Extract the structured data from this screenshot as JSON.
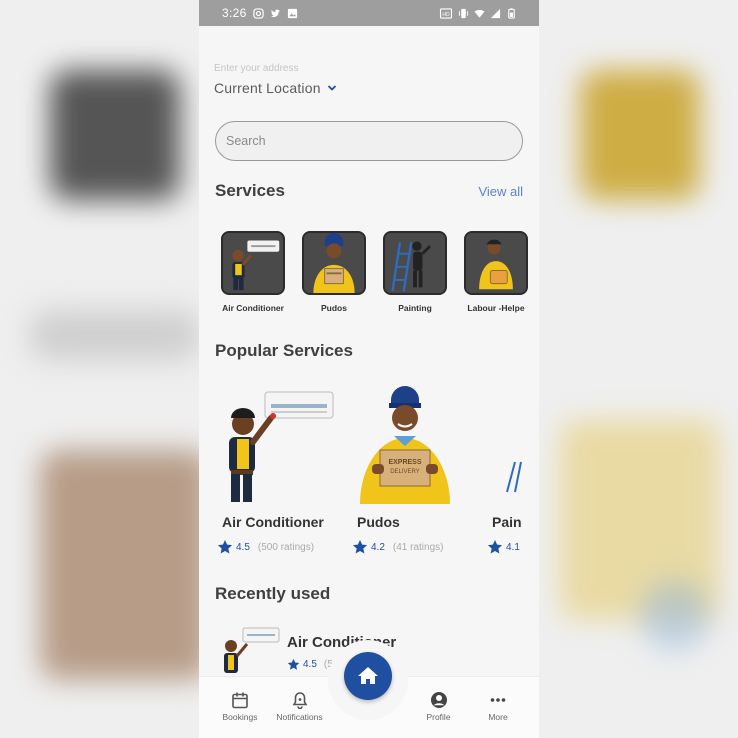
{
  "status_bar": {
    "time": "3:26"
  },
  "location": {
    "placeholder": "Enter your address",
    "current": "Current Location"
  },
  "search": {
    "placeholder": "Search"
  },
  "services": {
    "title": "Services",
    "view_all": "View all",
    "items": [
      {
        "label": "Air Conditioner"
      },
      {
        "label": "Pudos"
      },
      {
        "label": "Painting"
      },
      {
        "label": "Labour -Helpe"
      }
    ]
  },
  "popular": {
    "title": "Popular Services",
    "items": [
      {
        "title": "Air Conditioner",
        "rating": "4.5",
        "count": "(500 ratings)"
      },
      {
        "title": "Pudos",
        "rating": "4.2",
        "count": "(41 ratings)"
      },
      {
        "title": "Pain",
        "rating": "4.1",
        "count": ""
      }
    ]
  },
  "recent": {
    "title": "Recently used",
    "item": {
      "title": "Air Conditioner",
      "rating": "4.5",
      "count": "(500"
    }
  },
  "bottom_nav": {
    "bookings": "Bookings",
    "notifications": "Notifications",
    "profile": "Profile",
    "more": "More"
  },
  "colors": {
    "primary": "#1f4fa0",
    "accent_link": "#5b84c4",
    "status_bar": "#9e9e9e"
  }
}
